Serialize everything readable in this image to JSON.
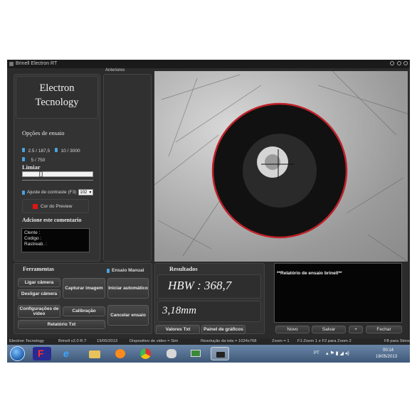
{
  "window": {
    "title": "Brinell Electron RT"
  },
  "brand": {
    "line1": "Electron",
    "line2": "Tecnology"
  },
  "options": {
    "title": "Opções de ensaio",
    "opt1": "2.5 / 187,5",
    "opt2": "10 / 3000",
    "opt3": "5 / 750"
  },
  "threshold": {
    "label": "Limiar",
    "level": 0.24
  },
  "contrast": {
    "label": "Ajuste de contraste (F3)",
    "value": "102"
  },
  "preview": {
    "label": "Cor do Preview",
    "color": "#e01515"
  },
  "comment": {
    "title": "Adcione este comentario",
    "client": "Clente   :",
    "code": "Codigo   :",
    "trace": "Rastreab. :"
  },
  "anteriores": {
    "label": "Anteriores"
  },
  "tools": {
    "title": "Ferramentas",
    "manual": "Ensaio Manual",
    "connect": "Ligar câmera",
    "disconnect": "Desligar câmera",
    "capture": "Capturar imagem",
    "auto": "Iniciar automático",
    "video_cfg": "Configurações de vídeo",
    "calib": "Calibração",
    "cancel": "Cancelar ensaio",
    "report": "Relatório Txt"
  },
  "results": {
    "title": "Resultados",
    "hbw": "HBW : 368,7",
    "diameter": "3,18mm",
    "values_btn": "Valores Txt",
    "graphs_btn": "Painel de gráficos"
  },
  "report_box": {
    "text": "**Relatório de ensaio brinell**",
    "new_btn": "Novo",
    "save_btn": "Salvar",
    "plus_btn": "+",
    "close_btn": "Fechar"
  },
  "status": {
    "company": "Electron Tecnology",
    "version": "Brinell v2.0 R.T",
    "date": "19/05/2013",
    "video": "Dispositivo de video = Sim",
    "resolution": "Resolução da tela = 1024x768",
    "zoom": "Zoom = 1",
    "zoom_hint": "F1:Zoom 1 e F2 para Zoom 2",
    "skins": "F8 para Skins."
  },
  "taskbar": {
    "lang": "PT",
    "time": "00:14",
    "date": "19/05/2013"
  },
  "colors": {
    "accent_blue": "#4aa3df",
    "ring_red": "#c0222a"
  }
}
